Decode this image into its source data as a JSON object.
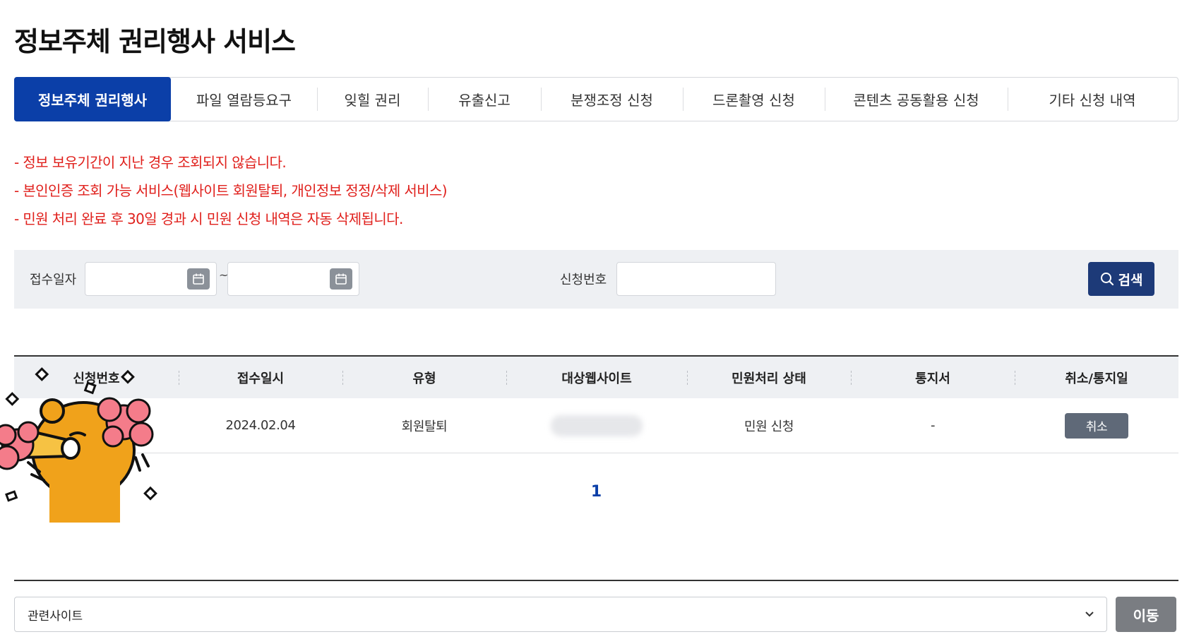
{
  "page": {
    "title": "정보주체 권리행사 서비스"
  },
  "tabs": [
    {
      "label": "정보주체 권리행사",
      "active": true
    },
    {
      "label": "파일 열람등요구",
      "active": false
    },
    {
      "label": "잊힐 권리",
      "active": false
    },
    {
      "label": "유출신고",
      "active": false
    },
    {
      "label": "분쟁조정 신청",
      "active": false
    },
    {
      "label": "드론촬영 신청",
      "active": false
    },
    {
      "label": "콘텐츠 공동활용 신청",
      "active": false
    },
    {
      "label": "기타 신청 내역",
      "active": false
    }
  ],
  "notices": [
    "- 정보 보유기간이 지난 경우 조회되지 않습니다.",
    "- 본인인증 조회 가능 서비스(웹사이트 회원탈퇴, 개인정보 정정/삭제 서비스)",
    "- 민원 처리 완료 후 30일 경과 시 민원 신청 내역은 자동 삭제됩니다."
  ],
  "search": {
    "date_label": "접수일자",
    "date_from": "",
    "date_to": "",
    "range_separator": "~",
    "request_no_label": "신청번호",
    "request_no_value": "",
    "search_button": "검색",
    "calendar_icon": "calendar-icon",
    "search_icon": "search-icon"
  },
  "table": {
    "headers": [
      "신청번호",
      "접수일시",
      "유형",
      "대상웹사이트",
      "민원처리 상태",
      "통지서",
      "취소/통지일"
    ],
    "rows": [
      {
        "request_no": "",
        "received_at": "2024.02.04",
        "type": "회원탈퇴",
        "target_site": "",
        "status": "민원 신청",
        "notice": "-",
        "action_label": "취소"
      }
    ]
  },
  "pagination": {
    "current": "1"
  },
  "footer": {
    "related_sites_label": "관련사이트",
    "go_button": "이동"
  },
  "colors": {
    "primary": "#0b3fa8",
    "notice_red": "#e0201c",
    "search_button": "#1d3a78",
    "panel_bg": "#eef0f3",
    "cancel_button": "#5f6978",
    "go_button": "#7a7d82"
  }
}
